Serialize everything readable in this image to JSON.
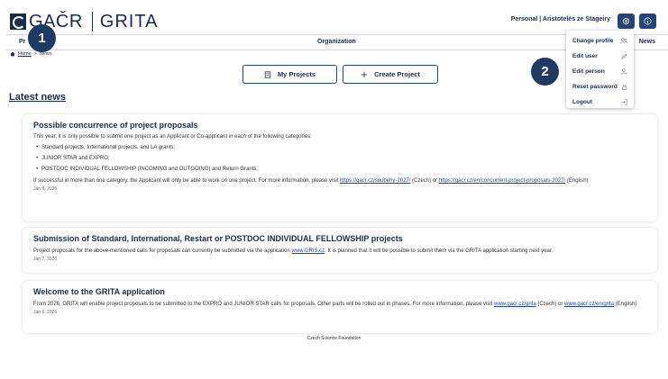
{
  "header": {
    "logo_text": "GAČR",
    "app_name": "GRITA",
    "user_label": "Personal | Aristotelés ze Stageiry"
  },
  "nav": {
    "left": "Pr",
    "center": "Organization",
    "right": "News"
  },
  "breadcrumb": {
    "home": "Home",
    "separator": ">",
    "current": "News"
  },
  "actions": {
    "my_projects": "My Projects",
    "create_project": "Create Project"
  },
  "latest_news_title": "Latest news",
  "news": [
    {
      "title": "Possible concurrence of project proposals",
      "intro": "This year, it is only possible to submit one project as an Applicant or Co-applicant in each of the following categories:",
      "bullets": [
        "Standard projects, International projects, and LA grants;",
        "JUNIOR STAR and EXPRO;",
        "POSTDOC INDIVIDUAL FELLOWSHIP (INCOMING and OUTGOING) and Return Grants."
      ],
      "outro_1": "If successful in more than one category, the Applicant will only be able to work on one project. For more information, please visit ",
      "link_1": "https://gacr.cz/soubehy-2027/",
      "outro_2": " (Czech) or ",
      "link_2": "https://gacr.cz/en/concurrent-project-proposals-2027/",
      "outro_3": " (English)",
      "date": "Jan 8, 2026"
    },
    {
      "title": "Submission of Standard, International, Restart or POSTDOC INDIVIDUAL FELLOWSHIP projects",
      "text_1": "Project proposals for the above-mentioned calls for proposals can currently be submitted via the application ",
      "link": "www.GRIS.cz",
      "text_2": ". It is planned that it will be possible to submit them via the GRITA application starting next year.",
      "date": "Jan 7, 2026"
    },
    {
      "title": "Welcome to the GRITA application",
      "text_1": "From 2026, GRITA will enable project proposals to be submitted to the EXPRO and JUNIOR STAR calls for proposals. Other parts will be rolled out in phases. For more information, please visit ",
      "link_1": "www.gacr.cz/grita",
      "text_2": " (Czech) or ",
      "link_2": "www.gacr.cz/en/grita",
      "text_3": " (English)",
      "date": "Jan 6, 2026"
    }
  ],
  "footer": "Czech Science Foundation",
  "menu": {
    "items": [
      {
        "label": "Change profile",
        "icon": "users-icon"
      },
      {
        "label": "Edit user",
        "icon": "pencil-icon"
      },
      {
        "label": "Edit person",
        "icon": "person-edit-icon"
      },
      {
        "label": "Reset password",
        "icon": "lock-icon"
      },
      {
        "label": "Logout",
        "icon": "logout-icon"
      }
    ]
  },
  "markers": {
    "one": "1",
    "two": "2"
  },
  "colors": {
    "primary": "#1b2b4a",
    "button": "#24457a",
    "link": "#1b3fa0"
  }
}
